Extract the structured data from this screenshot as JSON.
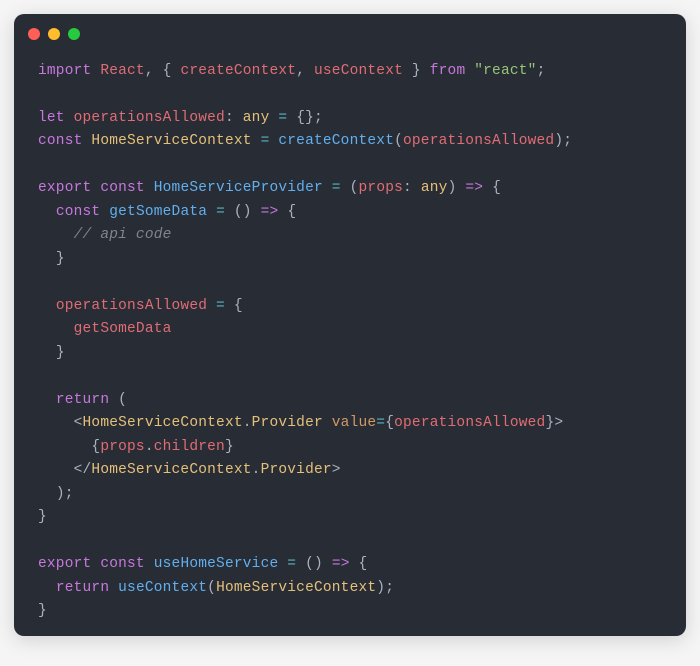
{
  "colors": {
    "bg": "#282c34",
    "fg": "#abb2bf",
    "red": "#e06c75",
    "blue": "#61afef",
    "purple": "#c678dd",
    "yellow": "#e5c07b",
    "green": "#98c379",
    "cyan": "#56b6c2",
    "orange": "#d19a66",
    "comment": "#7f848e"
  },
  "traffic": {
    "red": "#ff5f56",
    "yellow": "#ffbd2e",
    "green": "#27c93f"
  },
  "tok": {
    "import": "import",
    "React": "React",
    "createContext": "createContext",
    "useContext": "useContext",
    "from": "from",
    "react_str": "\"react\"",
    "let": "let",
    "operationsAllowed": "operationsAllowed",
    "any": "any",
    "const": "const",
    "HomeServiceContext": "HomeServiceContext",
    "export": "export",
    "HomeServiceProvider": "HomeServiceProvider",
    "props": "props",
    "arrow": "=>",
    "getSomeData": "getSomeData",
    "api_comment": "// api code",
    "return": "return",
    "Provider": "Provider",
    "value": "value",
    "children": "children",
    "useHomeService": "useHomeService",
    "eq": "=",
    "colon": ":",
    "semi": ";",
    "comma": ",",
    "lbrace": "{",
    "rbrace": "}",
    "lparen": "(",
    "rparen": ")",
    "empty_obj": "{}",
    "empty_paren": "()",
    "lt": "<",
    "gt": ">",
    "ltc": "</",
    "dot": "."
  }
}
